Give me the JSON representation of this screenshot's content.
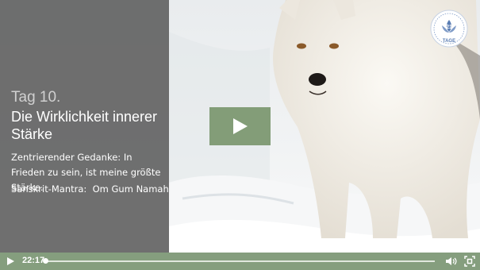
{
  "overlay": {
    "day": "Tag 10.",
    "title": "Die Wirklichkeit innerer Stärke",
    "centering_thought": "Zentrierender Gedanke: In Frieden zu sein, ist meine größte Stärke.",
    "mantra": "Sanskrit-Mantra:  Om Gum Namah"
  },
  "logo": {
    "word": "TAGE",
    "icon": "lotus-seal-icon"
  },
  "controls": {
    "current_time": "22:17",
    "progress": 0.0,
    "play_icon": "play-icon",
    "volume_icon": "volume-icon",
    "fullscreen_icon": "fullscreen-icon"
  },
  "colors": {
    "accent_green": "#7a966e",
    "panel_gray": "#585858",
    "logo_blue": "#5a7db3"
  }
}
